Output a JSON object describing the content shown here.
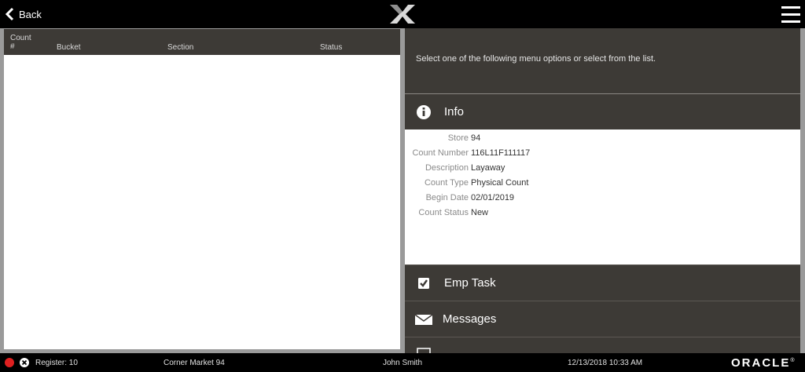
{
  "header": {
    "back_label": "Back"
  },
  "grid": {
    "columns": {
      "count": "Count\n#",
      "bucket": "Bucket",
      "section": "Section",
      "status": "Status"
    },
    "rows": []
  },
  "prompt": "Select one of the following menu options or select from the list.",
  "info": {
    "title": "Info",
    "fields": [
      {
        "label": "Store",
        "value": "94"
      },
      {
        "label": "Count Number",
        "value": "116L11F111117"
      },
      {
        "label": "Description",
        "value": "Layaway"
      },
      {
        "label": "Count Type",
        "value": "Physical Count"
      },
      {
        "label": "Begin Date",
        "value": "02/01/2019"
      },
      {
        "label": "Count Status",
        "value": "New"
      }
    ]
  },
  "menu": {
    "emp_task": "Emp Task",
    "messages": "Messages"
  },
  "status": {
    "register": "Register: 10",
    "store": "Corner Market 94",
    "user": "John Smith",
    "datetime": "12/13/2018 10:33 AM",
    "brand": "ORACLE",
    "brand_mark": "®"
  },
  "colors": {
    "dark_panel": "#3d3a36",
    "alert_red": "#e02020"
  }
}
